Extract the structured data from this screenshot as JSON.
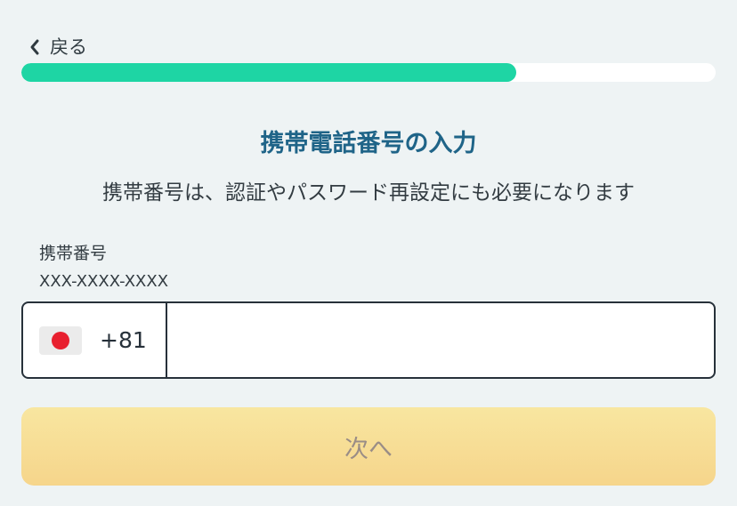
{
  "header": {
    "back_label": "戻る",
    "back_icon": "chevron-left-icon"
  },
  "progress": {
    "value": 0.713,
    "fill_color": "#1ed5a4",
    "track_color": "#ffffff"
  },
  "title": "携帯電話番号の入力",
  "subtitle": "携帯番号は、認証やパスワード再設定にも必要になります",
  "phone_field": {
    "label": "携帯番号",
    "format_hint": "XXX-XXXX-XXXX",
    "country_flag": "japan-flag-icon",
    "dial_code": "+81",
    "value": "",
    "placeholder": ""
  },
  "next_button": {
    "label": "次へ"
  },
  "colors": {
    "background": "#eef3f4",
    "title": "#1f6488",
    "button": "#f7dc93",
    "button_text": "#9a8d86"
  }
}
